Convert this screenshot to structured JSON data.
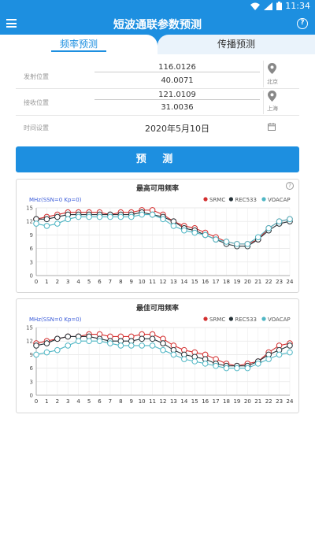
{
  "status": {
    "time": "11:34"
  },
  "appbar": {
    "title": "短波通联参数预测"
  },
  "tabs": [
    {
      "label": "频率预测",
      "active": true
    },
    {
      "label": "传播预测",
      "active": false
    }
  ],
  "form": {
    "tx": {
      "label": "发射位置",
      "lon": "116.0126",
      "lat": "40.0071",
      "city": "北京"
    },
    "rx": {
      "label": "接收位置",
      "lon": "121.0109",
      "lat": "31.0036",
      "city": "上海"
    },
    "time": {
      "label": "时间设置",
      "value": "2020年5月10日"
    }
  },
  "predict_button": {
    "label": "预 测"
  },
  "colors": {
    "primary": "#1d8fe0",
    "srmc": "#d32f2f",
    "rec533": "#263238",
    "voacap": "#4fb6c4"
  },
  "chart_data": [
    {
      "type": "line",
      "title": "最高可用频率",
      "unit_label": "MHz(SSN=0 Kp=0)",
      "x": [
        0,
        1,
        2,
        3,
        4,
        5,
        6,
        7,
        8,
        9,
        10,
        11,
        12,
        13,
        14,
        15,
        16,
        17,
        18,
        19,
        20,
        21,
        22,
        23,
        24
      ],
      "ylim": [
        0,
        15
      ],
      "yticks": [
        0,
        3,
        6,
        9,
        12,
        15
      ],
      "legend_position": "top-right",
      "grid": true,
      "series": [
        {
          "name": "SRMC",
          "color": "#d32f2f",
          "values": [
            12.5,
            13.0,
            13.5,
            14.0,
            14.0,
            14.0,
            14.0,
            13.5,
            14.0,
            14.0,
            14.5,
            14.5,
            13.5,
            12.0,
            11.0,
            10.5,
            9.5,
            8.5,
            7.5,
            7.0,
            7.0,
            8.0,
            10.5,
            12.0,
            12.5
          ]
        },
        {
          "name": "REC533",
          "color": "#263238",
          "values": [
            12.5,
            12.5,
            13.0,
            13.5,
            13.5,
            13.5,
            13.5,
            13.5,
            13.5,
            13.5,
            14.0,
            13.5,
            13.0,
            12.0,
            10.5,
            10.0,
            9.0,
            8.0,
            7.0,
            6.5,
            6.5,
            8.0,
            10.0,
            11.5,
            12.0
          ]
        },
        {
          "name": "VOACAP",
          "color": "#4fb6c4",
          "values": [
            11.5,
            11.0,
            11.5,
            12.5,
            13.0,
            13.0,
            13.0,
            13.0,
            13.0,
            13.0,
            13.5,
            13.5,
            12.5,
            11.0,
            10.0,
            9.5,
            9.0,
            8.0,
            7.5,
            7.0,
            7.0,
            8.5,
            10.5,
            12.0,
            12.5
          ]
        }
      ]
    },
    {
      "type": "line",
      "title": "最佳可用频率",
      "unit_label": "MHz(SSN=0 Kp=0)",
      "x": [
        0,
        1,
        2,
        3,
        4,
        5,
        6,
        7,
        8,
        9,
        10,
        11,
        12,
        13,
        14,
        15,
        16,
        17,
        18,
        19,
        20,
        21,
        22,
        23,
        24
      ],
      "ylim": [
        0,
        15
      ],
      "yticks": [
        0,
        3,
        6,
        9,
        12,
        15
      ],
      "legend_position": "top-right",
      "grid": true,
      "series": [
        {
          "name": "SRMC",
          "color": "#d32f2f",
          "values": [
            11.5,
            12.0,
            12.5,
            13.0,
            13.0,
            13.5,
            13.5,
            13.0,
            13.0,
            13.0,
            13.5,
            13.5,
            12.5,
            11.0,
            10.0,
            9.5,
            9.0,
            8.0,
            7.0,
            6.5,
            7.0,
            7.5,
            9.5,
            11.0,
            11.5
          ]
        },
        {
          "name": "REC533",
          "color": "#263238",
          "values": [
            11.0,
            11.5,
            12.5,
            13.0,
            13.0,
            13.0,
            12.5,
            12.0,
            12.0,
            12.0,
            12.5,
            12.5,
            11.5,
            10.0,
            9.0,
            8.5,
            8.0,
            7.0,
            6.5,
            6.5,
            6.5,
            7.5,
            9.0,
            10.0,
            11.0
          ]
        },
        {
          "name": "VOACAP",
          "color": "#4fb6c4",
          "values": [
            9.0,
            9.5,
            10.0,
            11.0,
            12.0,
            12.0,
            12.0,
            11.5,
            11.0,
            11.0,
            11.0,
            11.0,
            10.0,
            9.0,
            8.0,
            7.5,
            7.0,
            6.5,
            6.0,
            6.0,
            6.0,
            7.0,
            8.0,
            9.0,
            9.5
          ]
        }
      ]
    }
  ]
}
